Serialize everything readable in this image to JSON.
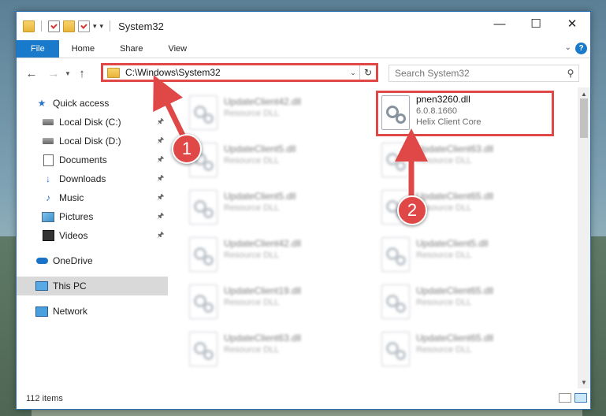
{
  "window": {
    "title": "System32"
  },
  "ribbon": {
    "tabs": [
      "File",
      "Home",
      "Share",
      "View"
    ],
    "help": "?"
  },
  "address": {
    "path": "C:\\Windows\\System32"
  },
  "search": {
    "placeholder": "Search System32"
  },
  "sidebar": {
    "items": [
      {
        "label": "Quick access",
        "icon": "star-icon"
      },
      {
        "label": "Local Disk (C:)",
        "icon": "drive-icon"
      },
      {
        "label": "Local Disk (D:)",
        "icon": "drive-icon"
      },
      {
        "label": "Documents",
        "icon": "documents-icon"
      },
      {
        "label": "Downloads",
        "icon": "downloads-icon"
      },
      {
        "label": "Music",
        "icon": "music-icon"
      },
      {
        "label": "Pictures",
        "icon": "pictures-icon"
      },
      {
        "label": "Videos",
        "icon": "videos-icon"
      },
      {
        "label": "OneDrive",
        "icon": "onedrive-icon"
      },
      {
        "label": "This PC",
        "icon": "this-pc-icon"
      },
      {
        "label": "Network",
        "icon": "network-icon"
      }
    ]
  },
  "files": {
    "highlighted": {
      "name": "pnen3260.dll",
      "version": "6.0.8.1660",
      "description": "Helix Client Core"
    },
    "left": [
      {
        "name": "UpdateClient42.dll",
        "type": "Resource DLL"
      },
      {
        "name": "UpdateClient5.dll",
        "type": "Resource DLL"
      },
      {
        "name": "UpdateClient5.dll",
        "type": "Resource DLL"
      },
      {
        "name": "UpdateClient42.dll",
        "type": "Resource DLL"
      },
      {
        "name": "UpdateClient19.dll",
        "type": "Resource DLL"
      },
      {
        "name": "UpdateClient63.dll",
        "type": "Resource DLL"
      }
    ],
    "right": [
      {
        "name": "UpdateClient63.dll",
        "type": "Resource DLL"
      },
      {
        "name": "UpdateClient65.dll",
        "type": "Resource DLL"
      },
      {
        "name": "UpdateClient5.dll",
        "type": "Resource DLL"
      },
      {
        "name": "UpdateClient65.dll",
        "type": "Resource DLL"
      },
      {
        "name": "UpdateClient65.dll",
        "type": "Resource DLL"
      }
    ]
  },
  "status": {
    "count": "112 items"
  },
  "callouts": {
    "one": "1",
    "two": "2"
  },
  "colors": {
    "accent": "#1979ca",
    "highlight": "#e04848"
  }
}
